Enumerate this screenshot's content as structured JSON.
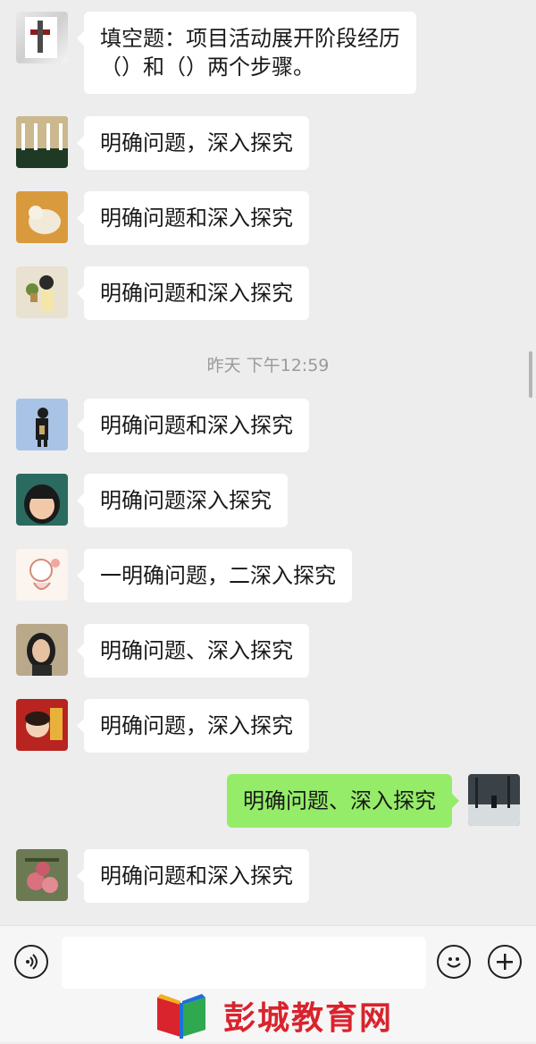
{
  "messages": [
    {
      "side": "left",
      "lines": [
        "填空题：项目活动展开阶段经历",
        "（）和（）两个步骤。"
      ],
      "avatar": "avatar-1"
    },
    {
      "side": "left",
      "lines": [
        "明确问题，深入探究"
      ],
      "avatar": "avatar-2"
    },
    {
      "side": "left",
      "lines": [
        "明确问题和深入探究"
      ],
      "avatar": "avatar-3"
    },
    {
      "side": "left",
      "lines": [
        "明确问题和深入探究"
      ],
      "avatar": "avatar-4"
    },
    {
      "side": "left",
      "lines": [
        "明确问题和深入探究"
      ],
      "avatar": "avatar-5"
    },
    {
      "side": "left",
      "lines": [
        "明确问题深入探究"
      ],
      "avatar": "avatar-6"
    },
    {
      "side": "left",
      "lines": [
        "一明确问题，二深入探究"
      ],
      "avatar": "avatar-7"
    },
    {
      "side": "left",
      "lines": [
        "明确问题、深入探究"
      ],
      "avatar": "avatar-8"
    },
    {
      "side": "left",
      "lines": [
        "明确问题，深入探究"
      ],
      "avatar": "avatar-9"
    },
    {
      "side": "right",
      "lines": [
        "明确问题、深入探究"
      ],
      "avatar": "avatar-self"
    },
    {
      "side": "left",
      "lines": [
        "明确问题和深入探究"
      ],
      "avatar": "avatar-10"
    }
  ],
  "timestamp": "昨天 下午12:59",
  "input_bar": {
    "voice_icon": "voice-icon",
    "emoji_icon": "emoji-icon",
    "plus_icon": "plus-icon",
    "input_value": ""
  },
  "watermark": {
    "text": "彭城教育网",
    "color": "#d9232d"
  }
}
